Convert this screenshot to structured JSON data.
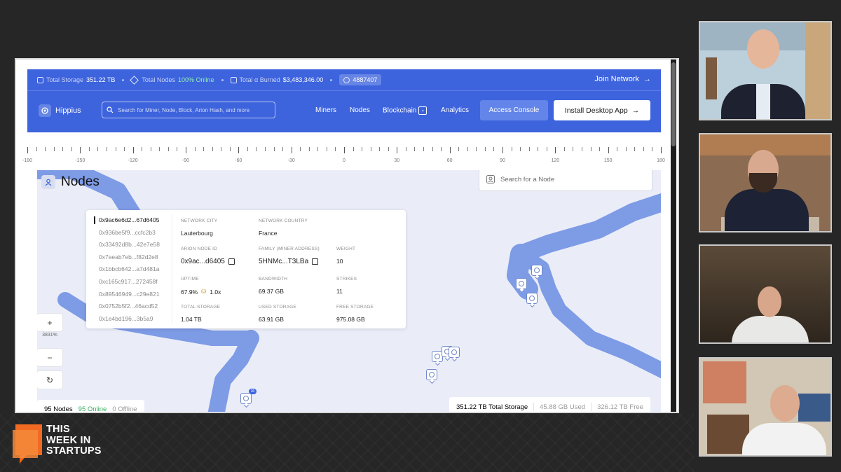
{
  "statbar": {
    "total_storage_label": "Total Storage",
    "total_storage_value": "351.22 TB",
    "total_nodes_label": "Total Nodes",
    "total_nodes_value": "100% Online",
    "burned_label": "Total α Burned",
    "burned_value": "$3,483,346.00",
    "block": "4887407",
    "join": "Join Network",
    "join_arrow": "→"
  },
  "nav": {
    "brand": "Hippius",
    "search_placeholder": "Search for Miner, Node, Block, Arion Hash, and more",
    "links": [
      "Miners",
      "Nodes",
      "Blockchain",
      "Analytics"
    ],
    "blockchain_chevron": "⌄",
    "console": "Access Console",
    "install": "Install Desktop App",
    "install_arrow": "→"
  },
  "ruler_labels": [
    "-180",
    "-150",
    "-120",
    "-90",
    "-60",
    "-30",
    "0",
    "30",
    "60",
    "90",
    "120",
    "150",
    "180"
  ],
  "map": {
    "title": "Nodes",
    "search_placeholder": "Search for a Node",
    "zoom_in": "+",
    "zoom_out": "−",
    "zoom_level": "3831%",
    "reset": "↻",
    "pin_badge": "30"
  },
  "popup": {
    "node_ids": [
      "0x9ac6e6d2...67d6405",
      "0x936be5f9...ccfc2b3",
      "0x33492d8b...42e7e58",
      "0x7eeab7eb...f82d2e8",
      "0x1bbcb642...a7d481a",
      "0xc165c917...272458f",
      "0x89546949...c29e821",
      "0x0752b5f2...46acd52",
      "0x1e4bd196...3b5a9"
    ],
    "network_city_label": "Network City",
    "network_city": "Lauterbourg",
    "network_country_label": "Network Country",
    "network_country": "France",
    "arion_node_id_label": "Arion Node ID",
    "arion_node_id": "0x9ac...d6405",
    "family_label": "Family (Miner Address)",
    "family": "5HNMc...T3LBa",
    "weight_label": "Weight",
    "weight": "10",
    "uptime_label": "Uptime",
    "uptime": "67.9%",
    "uptime_mult": "1.0x",
    "bandwidth_label": "Bandwidth",
    "bandwidth": "69.37 GB",
    "strikes_label": "Strikes",
    "strikes": "11",
    "total_storage_label": "Total Storage",
    "total_storage": "1.04 TB",
    "used_storage_label": "Used Storage",
    "used_storage": "63.91 GB",
    "free_storage_label": "Free Storage",
    "free_storage": "975.08 GB"
  },
  "footer": {
    "nodes": "95 Nodes",
    "online": "95 Online",
    "offline": "0 Offline",
    "total_storage": "351.22 TB Total Storage",
    "used": "45.88 GB Used",
    "free": "326.12 TB Free"
  },
  "brand_logo": {
    "line1": "THIS",
    "line2": "WEEK IN",
    "line3": "STARTUPS",
    "color": "#f26a21"
  },
  "colors": {
    "header_blue": "#3d63dd",
    "river_blue": "#7e9be6",
    "map_bg": "#eaedf8",
    "online_green": "#3aab5f"
  }
}
